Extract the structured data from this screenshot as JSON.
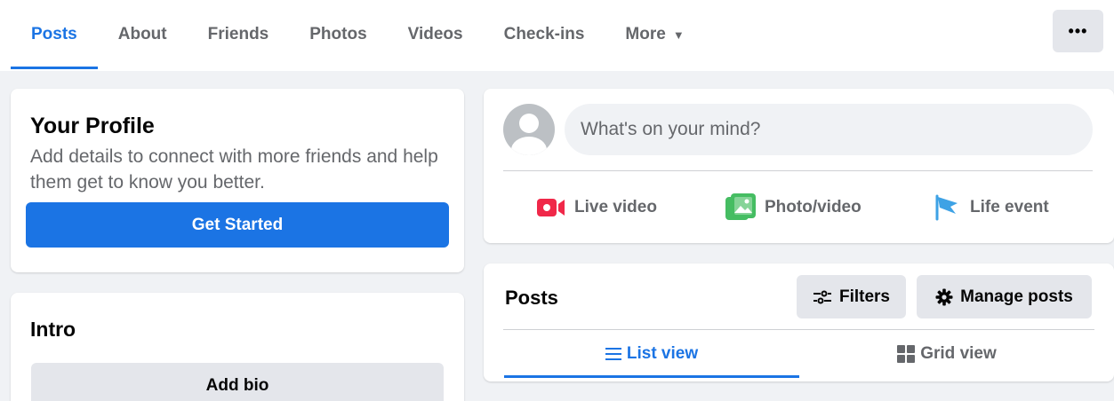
{
  "tabs": {
    "items": [
      {
        "label": "Posts",
        "active": true
      },
      {
        "label": "About"
      },
      {
        "label": "Friends"
      },
      {
        "label": "Photos"
      },
      {
        "label": "Videos"
      },
      {
        "label": "Check-ins"
      },
      {
        "label": "More",
        "icon": "caret-down-icon"
      }
    ],
    "overflow_label": "•••"
  },
  "profile": {
    "title": "Your Profile",
    "description": "Add details to connect with more friends and help them get to know you better.",
    "button_label": "Get Started"
  },
  "intro": {
    "title": "Intro",
    "add_bio_label": "Add bio"
  },
  "composer": {
    "placeholder": "What's on your mind?",
    "actions": [
      {
        "label": "Live video",
        "icon": "live-video-icon",
        "color": "#f02849"
      },
      {
        "label": "Photo/video",
        "icon": "photo-video-icon",
        "color": "#45bd62"
      },
      {
        "label": "Life event",
        "icon": "life-event-flag-icon",
        "color": "#3ea2e5"
      }
    ]
  },
  "posts": {
    "title": "Posts",
    "filters_label": "Filters",
    "manage_label": "Manage posts",
    "list_view_label": "List view",
    "grid_view_label": "Grid view"
  },
  "colors": {
    "accent": "#1b74e4",
    "background": "#f0f2f5",
    "button_gray": "#e4e6eb",
    "secondary_text": "#65676b"
  }
}
